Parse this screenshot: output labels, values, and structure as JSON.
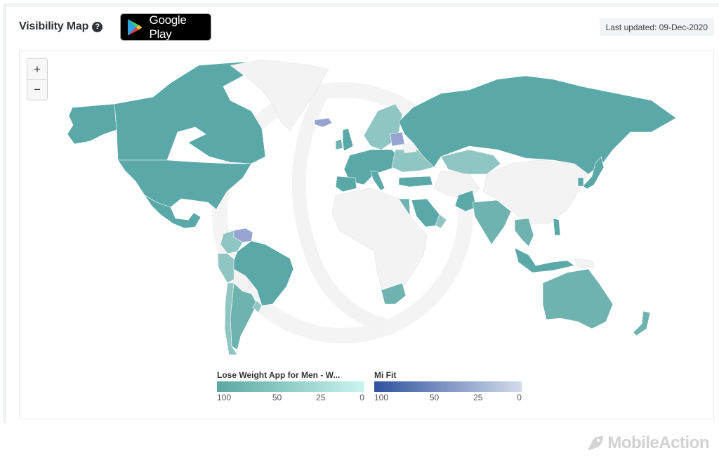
{
  "header": {
    "title": "Visibility Map",
    "help_icon": "question-circle-icon",
    "store_badge": {
      "label": "Google Play",
      "icon": "google-play-icon"
    },
    "last_updated": "Last updated: 09-Dec-2020"
  },
  "map": {
    "zoom_in_label": "+",
    "zoom_out_label": "−",
    "colors": {
      "no_data": "#f3f3f4",
      "border": "#e2e3e5",
      "app1_high": "#5aa8a8",
      "app1_mid": "#6fb3b1",
      "app1_low": "#8fc5c3",
      "app2_mid": "#97a3d1",
      "app2_low": "#b5c0e0"
    },
    "countries": [
      {
        "name": "Canada",
        "series": "app1",
        "level": "high"
      },
      {
        "name": "United States",
        "series": "app1",
        "level": "high"
      },
      {
        "name": "Alaska",
        "series": "app1",
        "level": "high"
      },
      {
        "name": "Mexico",
        "series": "app1",
        "level": "high"
      },
      {
        "name": "Greenland",
        "series": "none",
        "level": "none"
      },
      {
        "name": "Iceland",
        "series": "app2",
        "level": "mid"
      },
      {
        "name": "Venezuela",
        "series": "app2",
        "level": "mid"
      },
      {
        "name": "Colombia",
        "series": "app1",
        "level": "low"
      },
      {
        "name": "Peru",
        "series": "app1",
        "level": "low"
      },
      {
        "name": "Brazil",
        "series": "app1",
        "level": "high"
      },
      {
        "name": "Bolivia",
        "series": "none",
        "level": "none"
      },
      {
        "name": "Argentina",
        "series": "app1",
        "level": "mid"
      },
      {
        "name": "Chile",
        "series": "app1",
        "level": "low"
      },
      {
        "name": "Uruguay",
        "series": "app1",
        "level": "low"
      },
      {
        "name": "Scandinavia",
        "series": "app1",
        "level": "low"
      },
      {
        "name": "United Kingdom",
        "series": "app1",
        "level": "high"
      },
      {
        "name": "Ireland",
        "series": "app1",
        "level": "mid"
      },
      {
        "name": "Western Europe",
        "series": "app1",
        "level": "high"
      },
      {
        "name": "Iberia",
        "series": "app1",
        "level": "high"
      },
      {
        "name": "Italy",
        "series": "app1",
        "level": "high"
      },
      {
        "name": "Eastern Europe",
        "series": "app1",
        "level": "low"
      },
      {
        "name": "Latvia",
        "series": "app2",
        "level": "mid"
      },
      {
        "name": "Belarus",
        "series": "none",
        "level": "none"
      },
      {
        "name": "Russia",
        "series": "app1",
        "level": "high"
      },
      {
        "name": "Kazakhstan",
        "series": "app1",
        "level": "low"
      },
      {
        "name": "Turkey",
        "series": "app1",
        "level": "high"
      },
      {
        "name": "Tunisia",
        "series": "app2",
        "level": "low"
      },
      {
        "name": "Egypt",
        "series": "app1",
        "level": "mid"
      },
      {
        "name": "Saudi Arabia",
        "series": "app1",
        "level": "high"
      },
      {
        "name": "Oman",
        "series": "app1",
        "level": "low"
      },
      {
        "name": "Africa",
        "series": "none",
        "level": "none"
      },
      {
        "name": "South Africa",
        "series": "app1",
        "level": "mid"
      },
      {
        "name": "Central Asia",
        "series": "none",
        "level": "none"
      },
      {
        "name": "China",
        "series": "none",
        "level": "none"
      },
      {
        "name": "Pakistan",
        "series": "app1",
        "level": "high"
      },
      {
        "name": "India",
        "series": "app1",
        "level": "mid"
      },
      {
        "name": "Japan",
        "series": "app1",
        "level": "high"
      },
      {
        "name": "South Korea",
        "series": "app1",
        "level": "high"
      },
      {
        "name": "Southeast Asia",
        "series": "app1",
        "level": "mid"
      },
      {
        "name": "Indonesia",
        "series": "app1",
        "level": "high"
      },
      {
        "name": "Philippines",
        "series": "app1",
        "level": "high"
      },
      {
        "name": "Papua New Guinea",
        "series": "none",
        "level": "none"
      },
      {
        "name": "Australia",
        "series": "app1",
        "level": "mid"
      },
      {
        "name": "New Zealand",
        "series": "app1",
        "level": "mid"
      }
    ]
  },
  "legends": [
    {
      "title": "Lose Weight App for Men - W...",
      "gradient_from": "#5aa8a1",
      "gradient_to": "#c9f5ee",
      "ticks": [
        "100",
        "50",
        "25",
        "0"
      ]
    },
    {
      "title": "Mi Fit",
      "gradient_from": "#2f53a0",
      "gradient_to": "#d3dbea",
      "ticks": [
        "100",
        "50",
        "25",
        "0"
      ]
    }
  ],
  "watermark": {
    "label": "MobileAction",
    "icon": "rocket-icon"
  }
}
